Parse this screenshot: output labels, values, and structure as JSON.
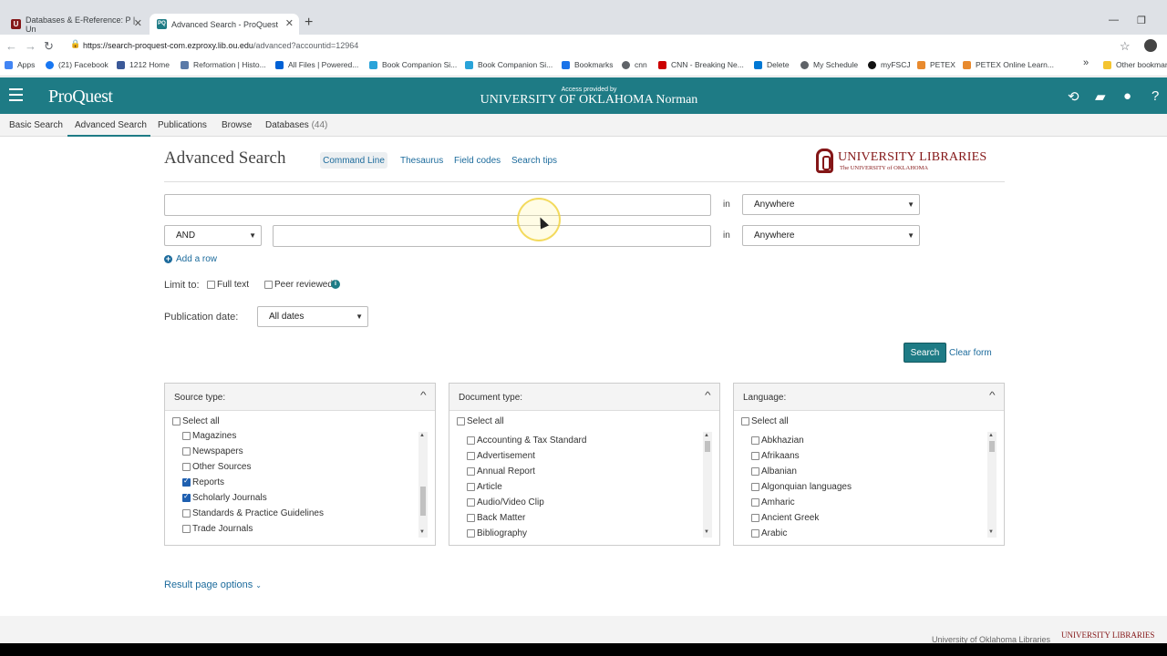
{
  "browser": {
    "tabs": [
      {
        "title": "Databases & E-Reference: P | Un",
        "active": false,
        "icon": "ou-favicon"
      },
      {
        "title": "Advanced Search - ProQuest",
        "active": true,
        "icon": "proquest-favicon"
      }
    ],
    "url_main": "https://search-proquest-com.ezproxy.lib.ou.edu",
    "url_rest": "/advanced?accountid=12964",
    "bookmarks": [
      "Apps",
      "(21) Facebook",
      "1212 Home",
      "Reformation | Histo...",
      "All Files | Powered...",
      "Book Companion Si...",
      "Book Companion Si...",
      "Bookmarks",
      "cnn",
      "CNN - Breaking Ne...",
      "Delete",
      "My Schedule",
      "myFSCJ",
      "PETEX",
      "PETEX Online Learn..."
    ],
    "overflow": "»",
    "other_bookmarks": "Other bookmarks"
  },
  "header": {
    "logo": "ProQuest",
    "access_label": "Access provided by",
    "institution": "UNIVERSITY OF OKLAHOMA Norman"
  },
  "nav": {
    "tabs": [
      "Basic Search",
      "Advanced Search",
      "Publications",
      "Browse",
      "Databases"
    ],
    "databases_count": "(44)"
  },
  "main": {
    "title": "Advanced Search",
    "links": {
      "command_line": "Command Line",
      "thesaurus": "Thesaurus",
      "field_codes": "Field codes",
      "search_tips": "Search tips"
    },
    "library_logo_main": "UNIVERSITY LIBRARIES",
    "library_logo_sub": "The UNIVERSITY of OKLAHOMA",
    "in_label": "in",
    "field_select_1": "Anywhere",
    "field_select_2": "Anywhere",
    "operator": "AND",
    "add_row": "Add a row",
    "limit_to_label": "Limit to:",
    "full_text": "Full text",
    "peer_reviewed": "Peer reviewed",
    "publication_date_label": "Publication date:",
    "publication_date_value": "All dates",
    "search_button": "Search",
    "clear_form": "Clear form",
    "result_page_options": "Result page options"
  },
  "panels": {
    "source": {
      "title": "Source type:",
      "select_all": "Select all",
      "items": [
        {
          "label": "Magazines",
          "checked": false
        },
        {
          "label": "Newspapers",
          "checked": false
        },
        {
          "label": "Other Sources",
          "checked": false
        },
        {
          "label": "Reports",
          "checked": true
        },
        {
          "label": "Scholarly Journals",
          "checked": true
        },
        {
          "label": "Standards & Practice Guidelines",
          "checked": false
        },
        {
          "label": "Trade Journals",
          "checked": false
        }
      ]
    },
    "document": {
      "title": "Document type:",
      "select_all": "Select all",
      "items": [
        {
          "label": "Accounting & Tax Standard",
          "checked": false
        },
        {
          "label": "Advertisement",
          "checked": false
        },
        {
          "label": "Annual Report",
          "checked": false
        },
        {
          "label": "Article",
          "checked": false
        },
        {
          "label": "Audio/Video Clip",
          "checked": false
        },
        {
          "label": "Back Matter",
          "checked": false
        },
        {
          "label": "Bibliography",
          "checked": false
        }
      ]
    },
    "language": {
      "title": "Language:",
      "select_all": "Select all",
      "items": [
        {
          "label": "Abkhazian",
          "checked": false
        },
        {
          "label": "Afrikaans",
          "checked": false
        },
        {
          "label": "Albanian",
          "checked": false
        },
        {
          "label": "Algonquian languages",
          "checked": false
        },
        {
          "label": "Amharic",
          "checked": false
        },
        {
          "label": "Ancient Greek",
          "checked": false
        },
        {
          "label": "Arabic",
          "checked": false
        }
      ]
    }
  },
  "footer": {
    "text": "University of Oklahoma Libraries",
    "logo": "UNIVERSITY LIBRARIES"
  },
  "colors": {
    "brand": "#1e7b85",
    "link": "#1c6b9c",
    "ou_crimson": "#841617"
  }
}
